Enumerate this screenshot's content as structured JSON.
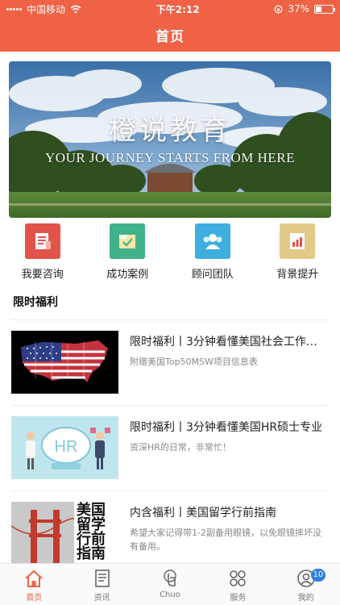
{
  "status_bar": {
    "carrier": "中国移动",
    "time": "下午2:12",
    "battery": "37%",
    "battery_level": 0.37
  },
  "nav": {
    "title": "首页"
  },
  "banner": {
    "title": "橙说教育",
    "subtitle": "YOUR JOURNEY STARTS FROM HERE"
  },
  "menu": [
    {
      "label": "我要咨询",
      "icon": "consult-icon",
      "color": "#e2534b"
    },
    {
      "label": "成功案例",
      "icon": "success-case-icon",
      "color": "#3fb28a"
    },
    {
      "label": "顾问团队",
      "icon": "team-icon",
      "color": "#3eaee0"
    },
    {
      "label": "背景提升",
      "icon": "chart-icon",
      "color": "#e2c987"
    }
  ],
  "section": {
    "title": "限时福利"
  },
  "articles": [
    {
      "title": "限时福利丨3分钟看懂美国社会工作专业",
      "desc": "附赠美国Top50MSW项目信息表",
      "thumb": "usa-flag-map"
    },
    {
      "title": "限时福利丨3分钟看懂美国HR硕士专业",
      "desc": "资深HR的日常，非常忙！",
      "thumb": "hr-illustration"
    },
    {
      "title": "内含福利丨美国留学行前指南",
      "desc": "希望大家记得带1-2副备用眼镜，以免眼镜摔坏没有备用。",
      "thumb": "guide-cover",
      "thumb_text": "美国留学行前指南"
    }
  ],
  "tabs": [
    {
      "label": "首页",
      "icon": "home-icon",
      "active": true
    },
    {
      "label": "资讯",
      "icon": "news-icon"
    },
    {
      "label": "Chuo",
      "icon": "chuo-icon"
    },
    {
      "label": "服务",
      "icon": "services-icon"
    },
    {
      "label": "我的",
      "icon": "profile-icon",
      "badge": "10"
    }
  ],
  "colors": {
    "accent": "#ef6245",
    "badge": "#2f7de1"
  }
}
